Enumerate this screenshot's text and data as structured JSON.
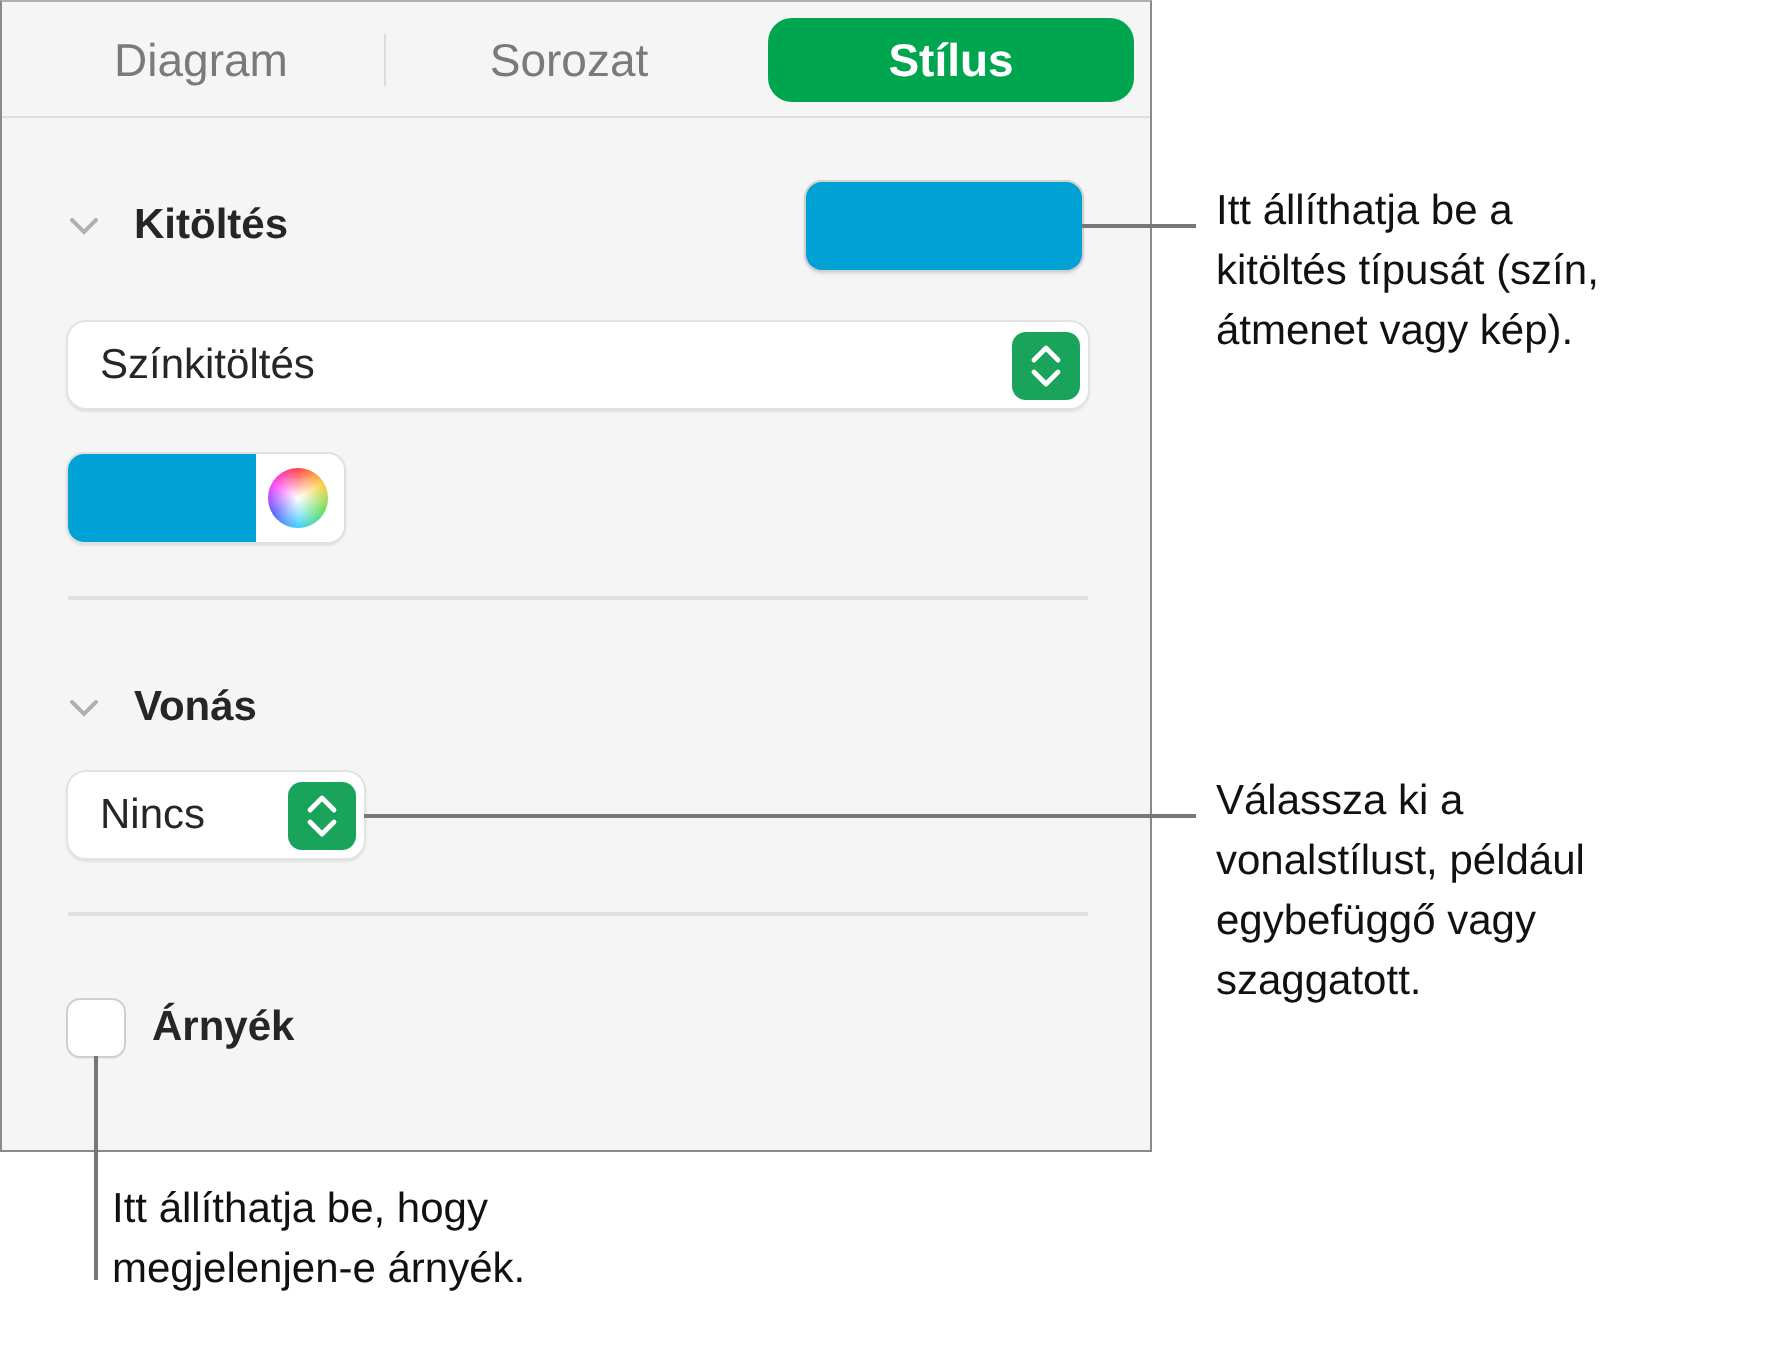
{
  "tabs": [
    {
      "label": "Diagram",
      "selected": false
    },
    {
      "label": "Sorozat",
      "selected": false
    },
    {
      "label": "Stílus",
      "selected": true
    }
  ],
  "sections": [
    {
      "kind": "fill",
      "title": "Kitöltés",
      "expanded": true,
      "popup": "Színkitöltés",
      "callout": "Itt állíthatja be a\nkitöltés típusát (szín,\nátmenet vagy kép)."
    },
    {
      "kind": "stroke",
      "title": "Vonás",
      "expanded": true,
      "popup": "Nincs",
      "callout": "Válassza ki a\nvonalstílust, például\negybefüggő vagy\nszaggatott."
    }
  ],
  "shadow": {
    "label": "Árnyék",
    "checked": false,
    "callout": "Itt állíthatja be, hogy\nmegjelenjen-e árnyék."
  }
}
